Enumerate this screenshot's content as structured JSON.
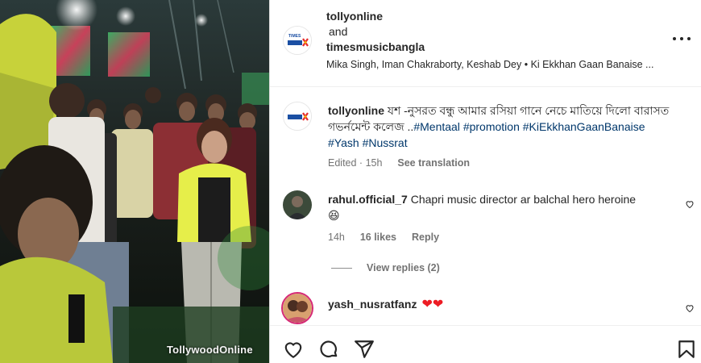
{
  "media": {
    "watermark": "TollywoodOnline"
  },
  "header": {
    "user1": "tollyonline",
    "conjunction": "and",
    "user2": "timesmusicbangla",
    "audio": "Mika Singh, Iman Chakraborty, Keshab Dey • Ki Ekkhan Gaan Banaise ..."
  },
  "caption": {
    "username": "tollyonline",
    "text": "যশ -নুসরত বন্ধু আমার রসিয়া গানে নেচে মাতিয়ে দিলো বারাসত গভর্নমেন্ট কলেজ ..",
    "hashtags": [
      "#Mentaal",
      "#promotion",
      "#KiEkkhanGaanBanaise",
      "#Yash",
      "#Nussrat"
    ],
    "edited": "Edited",
    "time": "15h",
    "see_translation": "See translation"
  },
  "comments": [
    {
      "username": "rahul.official_7",
      "text": "Chapri music director ar balchal hero heroine",
      "emoji": "😆",
      "time": "14h",
      "likes": "16 likes",
      "reply": "Reply",
      "view_replies": "View replies (2)"
    },
    {
      "username": "yash_nusratfanz",
      "emoji": "❤❤"
    }
  ],
  "colors": {
    "hashtag": "#00376b",
    "muted": "#737373",
    "text": "#262626",
    "heart_emoji": "#ed1c24"
  },
  "icons": [
    "more-options-icon",
    "like-heart-icon",
    "comment-icon",
    "share-icon",
    "bookmark-icon"
  ]
}
